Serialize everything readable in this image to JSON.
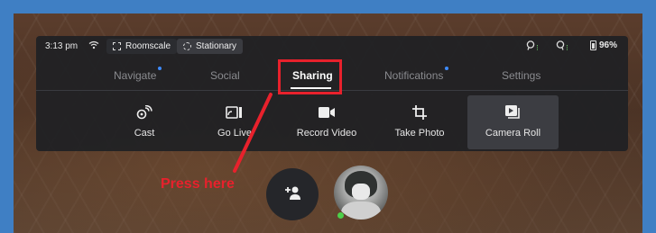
{
  "status_bar": {
    "time": "3:13 pm",
    "roomscale_label": "Roomscale",
    "stationary_label": "Stationary",
    "battery": "96%"
  },
  "tabs": [
    {
      "label": "Navigate",
      "active": false,
      "notification_dot": true
    },
    {
      "label": "Social",
      "active": false,
      "notification_dot": false
    },
    {
      "label": "Sharing",
      "active": true,
      "notification_dot": false
    },
    {
      "label": "Notifications",
      "active": false,
      "notification_dot": true
    },
    {
      "label": "Settings",
      "active": false,
      "notification_dot": false
    }
  ],
  "actions": [
    {
      "label": "Cast",
      "icon": "cast-icon"
    },
    {
      "label": "Go Live",
      "icon": "go-live-icon"
    },
    {
      "label": "Record Video",
      "icon": "record-video-icon"
    },
    {
      "label": "Take Photo",
      "icon": "take-photo-icon"
    },
    {
      "label": "Camera Roll",
      "icon": "camera-roll-icon",
      "hovered": true
    }
  ],
  "annotation": {
    "text": "Press here",
    "color": "#e8212c"
  },
  "colors": {
    "highlight": "#e8212c",
    "notification_dot": "#3d8bff",
    "online": "#4dd04a",
    "controller_ok": "#6cd06a"
  }
}
